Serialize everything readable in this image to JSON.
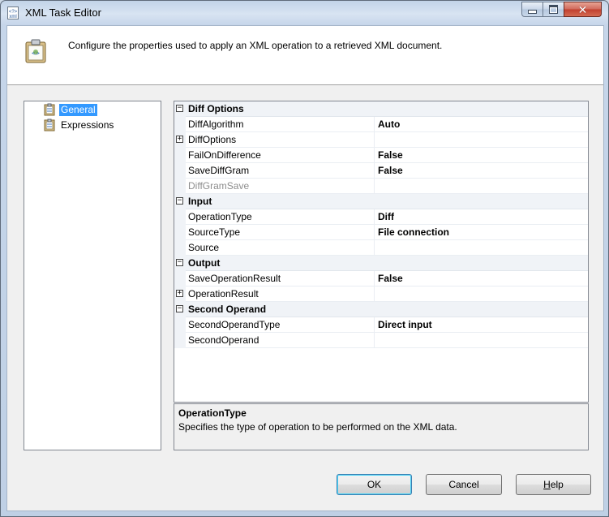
{
  "window": {
    "title": "XML Task Editor",
    "icon": "xml-task-icon"
  },
  "header": {
    "description": "Configure the properties used to apply an XML operation to a retrieved XML document.",
    "icon": "xml-task-large-icon"
  },
  "nav": {
    "items": [
      {
        "label": "General",
        "selected": true,
        "icon": "properties-page-icon"
      },
      {
        "label": "Expressions",
        "selected": false,
        "icon": "expressions-page-icon"
      }
    ]
  },
  "grid": {
    "categories": [
      {
        "name": "Diff Options",
        "expanded": true,
        "properties": [
          {
            "name": "DiffAlgorithm",
            "value": "Auto",
            "expandable": false,
            "disabled": false
          },
          {
            "name": "DiffOptions",
            "value": "",
            "expandable": true,
            "disabled": false
          },
          {
            "name": "FailOnDifference",
            "value": "False",
            "expandable": false,
            "disabled": false
          },
          {
            "name": "SaveDiffGram",
            "value": "False",
            "expandable": false,
            "disabled": false
          },
          {
            "name": "DiffGramSave",
            "value": "",
            "expandable": false,
            "disabled": true
          }
        ]
      },
      {
        "name": "Input",
        "expanded": true,
        "properties": [
          {
            "name": "OperationType",
            "value": "Diff",
            "expandable": false,
            "disabled": false
          },
          {
            "name": "SourceType",
            "value": "File connection",
            "expandable": false,
            "disabled": false
          },
          {
            "name": "Source",
            "value": "",
            "expandable": false,
            "disabled": false
          }
        ]
      },
      {
        "name": "Output",
        "expanded": true,
        "properties": [
          {
            "name": "SaveOperationResult",
            "value": "False",
            "expandable": false,
            "disabled": false
          },
          {
            "name": "OperationResult",
            "value": "",
            "expandable": true,
            "disabled": false
          }
        ]
      },
      {
        "name": "Second Operand",
        "expanded": true,
        "properties": [
          {
            "name": "SecondOperandType",
            "value": "Direct input",
            "expandable": false,
            "disabled": false
          },
          {
            "name": "SecondOperand",
            "value": "",
            "expandable": false,
            "disabled": false
          }
        ]
      }
    ]
  },
  "description_panel": {
    "title": "OperationType",
    "text": "Specifies the type of operation to be performed on the XML data."
  },
  "buttons": {
    "ok": "OK",
    "cancel": "Cancel",
    "help_prefix": "",
    "help_mnemonic": "H",
    "help_rest": "elp"
  },
  "colors": {
    "selection": "#3399ff",
    "grid_margin": "#f0f3f7",
    "disabled_text": "#8d8d8d"
  }
}
